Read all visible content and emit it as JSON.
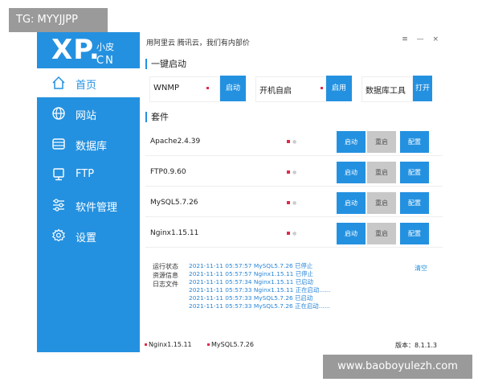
{
  "watermarks": {
    "top_left": "TG: MYYJJPP",
    "bottom_right": "www.baoboyulezh.com"
  },
  "logo": {
    "brand": "XP.",
    "sub_top": "小皮",
    "sub_bottom": "CN"
  },
  "window": {
    "title": "用阿里云 腾讯云，我们有内部价",
    "controls": "≡ — ×"
  },
  "nav": [
    {
      "label": "首页",
      "icon": "home-icon",
      "active": true
    },
    {
      "label": "网站",
      "icon": "globe-icon",
      "active": false
    },
    {
      "label": "数据库",
      "icon": "database-icon",
      "active": false
    },
    {
      "label": "FTP",
      "icon": "monitor-icon",
      "active": false
    },
    {
      "label": "软件管理",
      "icon": "sliders-icon",
      "active": false
    },
    {
      "label": "设置",
      "icon": "gear-icon",
      "active": false
    }
  ],
  "quick": {
    "title": "一键启动",
    "items": [
      {
        "name": "WNMP",
        "button": "启动"
      },
      {
        "name": "开机自启",
        "button": "启用"
      },
      {
        "name": "数据库工具",
        "button": "打开"
      }
    ]
  },
  "suite": {
    "title": "套件",
    "rows": [
      {
        "name": "Apache2.4.39",
        "start": "启动",
        "restart": "重启",
        "config": "配置"
      },
      {
        "name": "FTP0.9.60",
        "start": "启动",
        "restart": "重启",
        "config": "配置"
      },
      {
        "name": "MySQL5.7.26",
        "start": "启动",
        "restart": "重启",
        "config": "配置"
      },
      {
        "name": "Nginx1.15.11",
        "start": "启动",
        "restart": "重启",
        "config": "配置"
      }
    ]
  },
  "log": {
    "labels": [
      "运行状态",
      "资源信息",
      "日志文件"
    ],
    "clear": "清空",
    "lines": [
      "2021-11-11 05:57:57 MySQL5.7.26 已停止",
      "2021-11-11 05:57:57 Nginx1.15.11 已停止",
      "2021-11-11 05:57:34 Nginx1.15.11 已启动",
      "2021-11-11 05:57:33 Nginx1.15.11 正在启动......",
      "2021-11-11 05:57:33 MySQL5.7.26 已启动",
      "2021-11-11 05:57:33 MySQL5.7.26 正在启动......"
    ]
  },
  "status": {
    "items": [
      "Nginx1.15.11",
      "MySQL5.7.26"
    ],
    "version": "版本：8.1.1.3"
  },
  "colors": {
    "accent": "#2491e0",
    "indicator": "#e02b4a",
    "restart_bg": "#c8c8c8"
  }
}
